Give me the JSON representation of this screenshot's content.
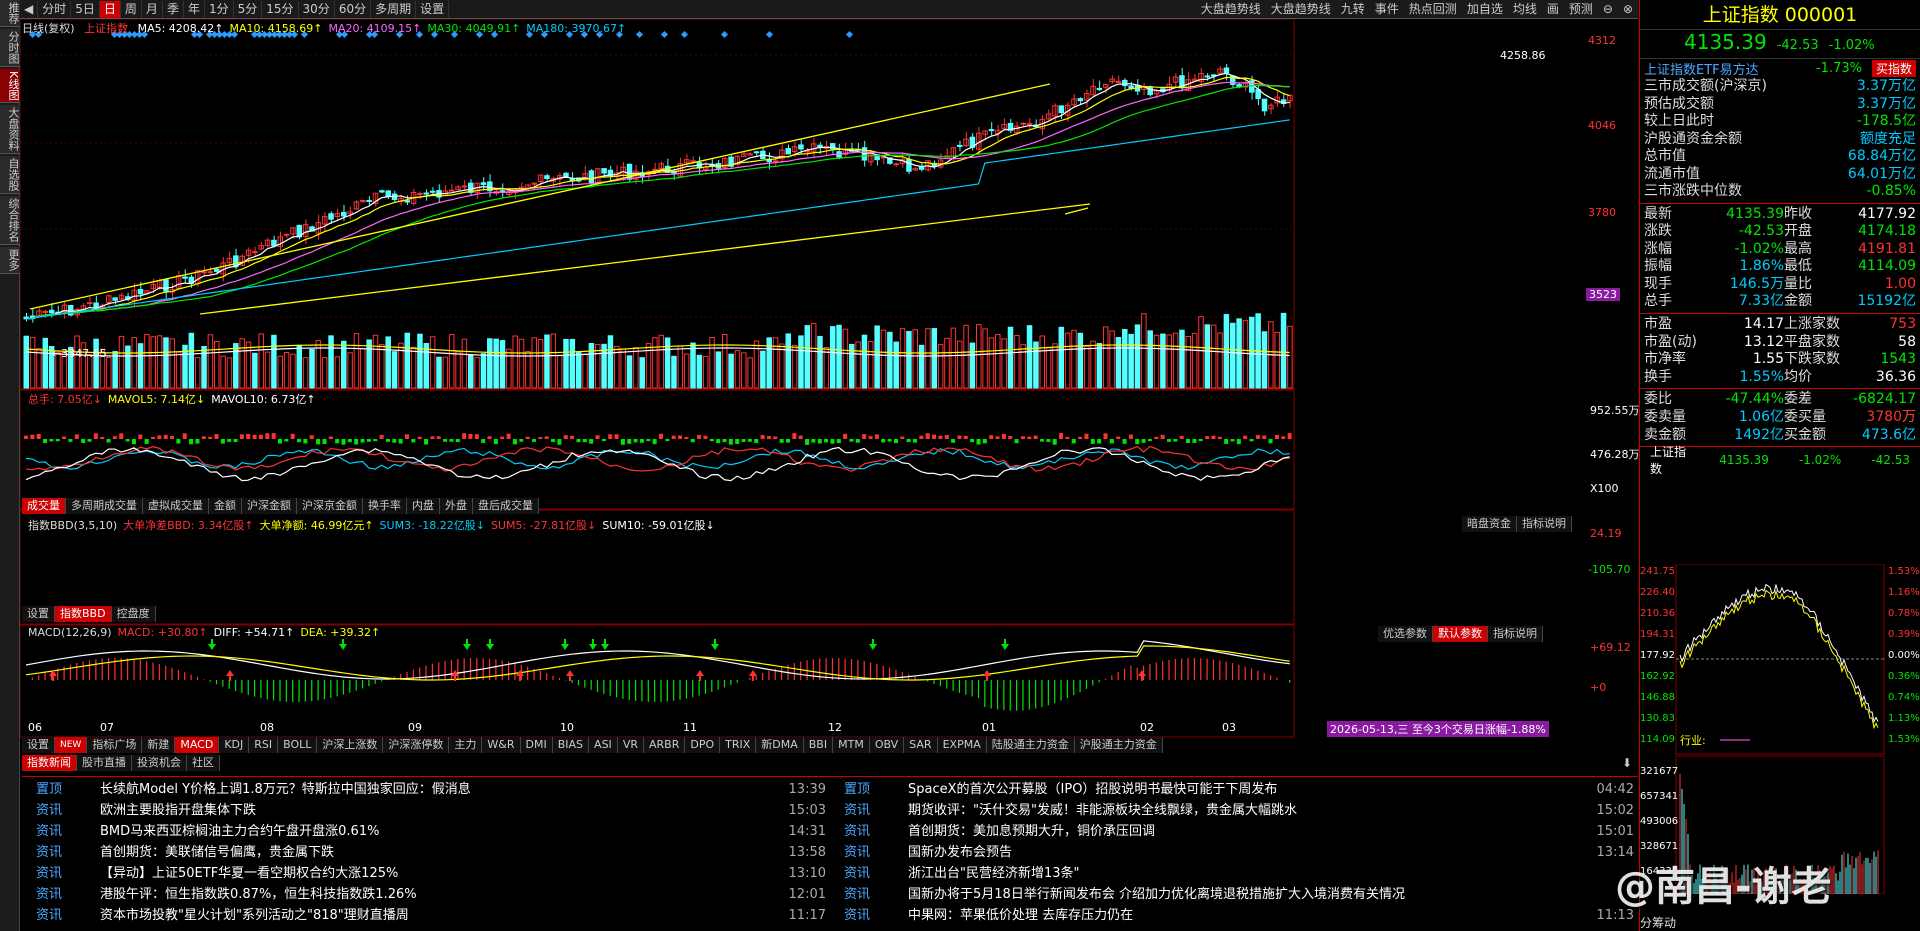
{
  "leftbar": {
    "tabs": [
      "推荐",
      "分时图",
      "K线图",
      "大盘资料",
      "自选股",
      "综合排名",
      "更多"
    ]
  },
  "topbar": {
    "period_tabs": [
      "分时",
      "5日",
      "日",
      "周",
      "月",
      "季",
      "年",
      "1分",
      "5分",
      "15分",
      "30分",
      "60分",
      "多周期",
      "设置"
    ],
    "right_tools": [
      "大盘趋势线",
      "大盘趋势线",
      "九转",
      "事件",
      "热点回测",
      "加自选",
      "均线",
      "画",
      "预测"
    ]
  },
  "kline": {
    "title": "日线(复权)",
    "name": "上证指数",
    "ma": [
      {
        "label": "MA5: 4208.42↑",
        "color": "#ffffff"
      },
      {
        "label": "MA10: 4158.69↑",
        "color": "#ffff00"
      },
      {
        "label": "MA20: 4109.15↑",
        "color": "#ff66ff"
      },
      {
        "label": "MA30: 4049.91↑",
        "color": "#00e600"
      },
      {
        "label": "MA180: 3970.67↑",
        "color": "#00ccff"
      }
    ],
    "axis": [
      "4312",
      "4046",
      "3780",
      "3523"
    ],
    "high_label": "4258.86",
    "low_label": "←3347.65"
  },
  "volume": {
    "header": [
      {
        "label": "总手: 7.05亿↓",
        "color": "#ff3232"
      },
      {
        "label": "MAVOL5: 7.14亿↓",
        "color": "#ffff00"
      },
      {
        "label": "MAVOL10: 6.73亿↑",
        "color": "#ffffff"
      }
    ],
    "axis": [
      "952.55万",
      "476.28万",
      "X100"
    ],
    "tabs": [
      "成交量",
      "多周期成交量",
      "虚拟成交量",
      "金额",
      "沪深金额",
      "沪深京金额",
      "换手率",
      "内盘",
      "外盘",
      "盘后成交量"
    ]
  },
  "bbd": {
    "header": [
      {
        "label": "指数BBD(3,5,10)",
        "color": "#dddddd"
      },
      {
        "label": "大单净差BBD: 3.34亿股↑",
        "color": "#ff3232"
      },
      {
        "label": "大单净额: 46.99亿元↑",
        "color": "#ffff00"
      },
      {
        "label": "SUM3: -18.22亿股↓",
        "color": "#00ccff"
      },
      {
        "label": "SUM5: -27.81亿股↓",
        "color": "#ff3232"
      },
      {
        "label": "SUM10: -59.01亿股↓",
        "color": "#ffffff"
      }
    ],
    "axis": [
      "24.19",
      "-105.70"
    ],
    "right_buttons": [
      "暗盘资金",
      "指标说明"
    ],
    "tabs": [
      "设置",
      "指数BBD",
      "控盘度"
    ]
  },
  "macd": {
    "header": [
      {
        "label": "MACD(12,26,9)",
        "color": "#dddddd"
      },
      {
        "label": "MACD: +30.80↑",
        "color": "#ff3232"
      },
      {
        "label": "DIFF: +54.71↑",
        "color": "#ffffff"
      },
      {
        "label": "DEA: +39.32↑",
        "color": "#ffff00"
      }
    ],
    "axis": [
      "+69.12",
      "+0"
    ],
    "right_buttons": [
      "优选参数",
      "默认参数",
      "指标说明"
    ],
    "months": [
      "06",
      "07",
      "08",
      "09",
      "10",
      "11",
      "12",
      "01",
      "02",
      "03"
    ],
    "note": "2026-05-13,三 至今3个交易日涨幅-1.88%",
    "tabs": [
      "设置",
      "NEW",
      "指标广场",
      "新建",
      "MACD",
      "KDJ",
      "RSI",
      "BOLL",
      "沪深上涨数",
      "沪深涨停数",
      "主力",
      "W&R",
      "DMI",
      "BIAS",
      "ASI",
      "VR",
      "ARBR",
      "DPO",
      "TRIX",
      "新DMA",
      "BBI",
      "MTM",
      "OBV",
      "SAR",
      "EXPMA",
      "陆股通主力资金",
      "沪股通主力资金"
    ]
  },
  "news": {
    "tabs": [
      "指数新闻",
      "股市直播",
      "投资机会",
      "社区"
    ],
    "left": [
      {
        "tag": "置顶",
        "title": "长续航Model Y价格上调1.8万元？特斯拉中国独家回应：假消息",
        "time": "13:39"
      },
      {
        "tag": "资讯",
        "title": "欧洲主要股指开盘集体下跌",
        "time": "15:03"
      },
      {
        "tag": "资讯",
        "title": "BMD马来西亚棕榈油主力合约午盘开盘涨0.61%",
        "time": "14:31"
      },
      {
        "tag": "资讯",
        "title": "首创期货：美联储信号偏鹰，贵金属下跌",
        "time": "13:58"
      },
      {
        "tag": "资讯",
        "title": "【异动】上证50ETF华夏一看空期权合约大涨125%",
        "time": "13:10"
      },
      {
        "tag": "资讯",
        "title": "港股午评：恒生指数跌0.87%，恒生科技指数跌1.26%",
        "time": "12:01"
      },
      {
        "tag": "资讯",
        "title": "资本市场投教\"星火计划\"系列活动之\"818\"理财直播周",
        "time": "11:17"
      }
    ],
    "right": [
      {
        "tag": "置顶",
        "title": "SpaceX的首次公开募股（IPO）招股说明书最快可能于下周发布",
        "time": "04:42"
      },
      {
        "tag": "资讯",
        "title": "期货收评：\"沃什交易\"发威！非能源板块全线飘绿，贵金属大幅跳水",
        "time": "15:02"
      },
      {
        "tag": "资讯",
        "title": "首创期货：美加息预期大升，铜价承压回调",
        "time": "15:01"
      },
      {
        "tag": "资讯",
        "title": "国新办发布会预告",
        "time": "13:14"
      },
      {
        "tag": "资讯",
        "title": "浙江出台\"民营经济新增13条\"",
        "time": ""
      },
      {
        "tag": "资讯",
        "title": "国新办将于5月18日举行新闻发布会 介绍加力优化离境退税措施扩大入境消费有关情况",
        "time": ""
      },
      {
        "tag": "资讯",
        "title": "中果网：苹果低价处理 去库存压力仍在",
        "time": "11:13"
      }
    ]
  },
  "right_panel": {
    "title": "上证指数 000001",
    "price": "4135.39",
    "change": "-42.53",
    "pct": "-1.02%",
    "etf": {
      "name": "上证指数ETF易方达",
      "pct": "-1.73%",
      "btn": "买指数"
    },
    "stats": [
      {
        "k": "三市成交额(沪深京)",
        "v": "3.37万亿",
        "c": "#00ccff"
      },
      {
        "k": "预估成交额",
        "v": "3.37万亿",
        "c": "#00ccff"
      },
      {
        "k": "较上日此时",
        "v": "-178.5亿",
        "c": "#00e600"
      },
      {
        "k": "沪股通资金余额",
        "v": "额度充足",
        "c": "#00ccff"
      },
      {
        "k": "总市值",
        "v": "68.84万亿",
        "c": "#00ccff"
      },
      {
        "k": "流通市值",
        "v": "64.01万亿",
        "c": "#00ccff"
      },
      {
        "k": "三市涨跌中位数",
        "v": "-0.85%",
        "c": "#00e600"
      }
    ],
    "quote": [
      {
        "k1": "最新",
        "v1": "4135.39",
        "c1": "#00e600",
        "k2": "昨收",
        "v2": "4177.92",
        "c2": "#ffffff"
      },
      {
        "k1": "涨跌",
        "v1": "-42.53",
        "c1": "#00e600",
        "k2": "开盘",
        "v2": "4174.18",
        "c2": "#00e600"
      },
      {
        "k1": "涨幅",
        "v1": "-1.02%",
        "c1": "#00e600",
        "k2": "最高",
        "v2": "4191.81",
        "c2": "#ff3232"
      },
      {
        "k1": "振幅",
        "v1": "1.86%",
        "c1": "#00ccff",
        "k2": "最低",
        "v2": "4114.09",
        "c2": "#00e600"
      },
      {
        "k1": "现手",
        "v1": "146.5万",
        "c1": "#00ccff",
        "k2": "量比",
        "v2": "1.00",
        "c2": "#ff3232"
      },
      {
        "k1": "总手",
        "v1": "7.33亿",
        "c1": "#00ccff",
        "k2": "金额",
        "v2": "15192亿",
        "c2": "#00ccff"
      }
    ],
    "breadth": [
      {
        "k1": "市盈",
        "v1": "14.17",
        "c1": "#ffffff",
        "k2": "上涨家数",
        "v2": "753",
        "c2": "#ff3232"
      },
      {
        "k1": "市盈(动)",
        "v1": "13.12",
        "c1": "#ffffff",
        "k2": "平盘家数",
        "v2": "58",
        "c2": "#ffffff"
      },
      {
        "k1": "市净率",
        "v1": "1.55",
        "c1": "#ffffff",
        "k2": "下跌家数",
        "v2": "1543",
        "c2": "#00e600"
      },
      {
        "k1": "换手",
        "v1": "1.55%",
        "c1": "#00ccff",
        "k2": "均价",
        "v2": "36.36",
        "c2": "#ffffff"
      }
    ],
    "orders": [
      {
        "k1": "委比",
        "v1": "-47.44%",
        "c1": "#00e600",
        "k2": "委差",
        "v2": "-6824.17万",
        "c2": "#00e600"
      },
      {
        "k1": "委卖量",
        "v1": "1.06亿",
        "c1": "#00ccff",
        "k2": "委买量",
        "v2": "3780万",
        "c2": "#ff3232"
      },
      {
        "k1": "卖金额",
        "v1": "1492亿",
        "c1": "#00ccff",
        "k2": "买金额",
        "v2": "473.6亿",
        "c2": "#00ccff"
      }
    ],
    "mini": {
      "name": "上证指数",
      "price": "4135.39",
      "pct": "-1.02%",
      "chg": "-42.53",
      "left_axis": [
        "241.75",
        "226.40",
        "210.36",
        "194.31",
        "177.92",
        "162.92",
        "146.88",
        "130.83",
        "114.09"
      ],
      "right_axis": [
        "1.53%",
        "1.16%",
        "0.78%",
        "0.39%",
        "0.00%",
        "0.36%",
        "0.74%",
        "1.13%",
        "1.53%"
      ],
      "vol_axis": [
        "321677",
        "657341",
        "493006",
        "328671",
        "164335"
      ],
      "industry": "行业:",
      "tabs": [
        "分",
        "筹",
        "动"
      ]
    }
  },
  "watermark": "@南昌-谢老"
}
